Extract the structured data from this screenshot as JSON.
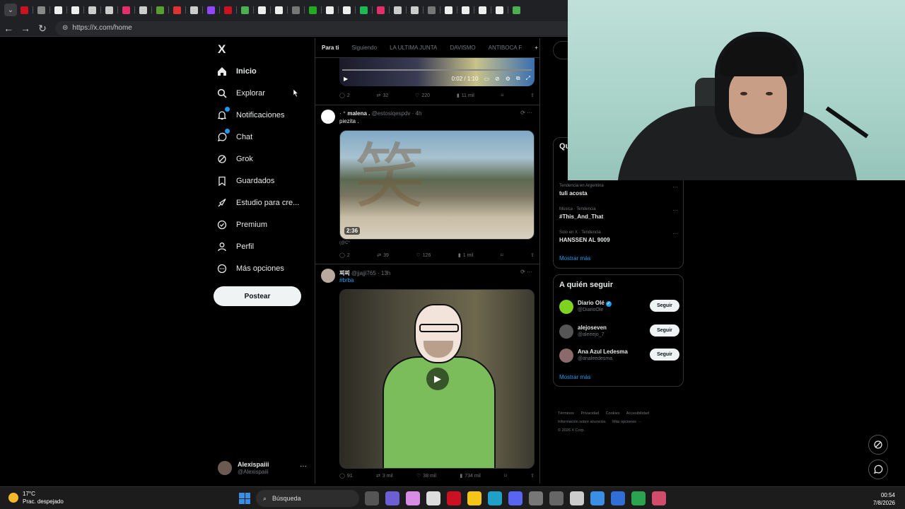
{
  "browser": {
    "url": "https://x.com/home"
  },
  "nav": {
    "logo": "X",
    "items": [
      {
        "label": "Inicio",
        "icon": "home-icon"
      },
      {
        "label": "Explorar",
        "icon": "search-icon"
      },
      {
        "label": "Notificaciones",
        "icon": "bell-icon"
      },
      {
        "label": "Chat",
        "icon": "chat-icon"
      },
      {
        "label": "Grok",
        "icon": "grok-icon"
      },
      {
        "label": "Guardados",
        "icon": "bookmark-icon"
      },
      {
        "label": "Estudio para cre...",
        "icon": "rocket-icon"
      },
      {
        "label": "Premium",
        "icon": "premium-icon"
      },
      {
        "label": "Perfil",
        "icon": "person-icon"
      },
      {
        "label": "Más opciones",
        "icon": "more-icon"
      }
    ],
    "post_label": "Postear",
    "account": {
      "name": "Alexispaiii",
      "handle": "@Alexispaiii",
      "more": "···"
    }
  },
  "feed": {
    "tabs": [
      "Para ti",
      "Siguiendo",
      "LA ULTIMA JUNTA",
      "DAVISMO",
      "ANTIBOCA F"
    ],
    "tab_plus": "+",
    "video1": {
      "time": "0:02 / 1:10"
    },
    "tweet0_actions": {
      "replies": "2",
      "retweets": "32",
      "likes": "220",
      "views": "11 mil"
    },
    "tweet1": {
      "name": "malena .",
      "handle": "@estosiqespdv · 4h",
      "text": "piezita .",
      "duration": "2:36",
      "source": "(@C*",
      "replies": "2",
      "retweets": "39",
      "likes": "126",
      "views": "1 mil"
    },
    "tweet2": {
      "name": "찌찌",
      "handle": "@jjajji765 · 13h",
      "text": "#brba",
      "replies": "91",
      "retweets": "3 mil",
      "likes": "38 mil",
      "views": "734 mil"
    }
  },
  "right": {
    "trends_title": "Qu",
    "trends": [
      {
        "cat": "Tendencia en Argentina",
        "name": "tuli acosta"
      },
      {
        "cat": "Música · Tendencia",
        "name": "#This_And_That"
      },
      {
        "cat": "Solo en X · Tendencia",
        "name": "HANSSEN AL 9009"
      }
    ],
    "show_more": "Mostrar más",
    "follow_title": "A quién seguir",
    "follow": [
      {
        "name": "Diario Olé",
        "handle": "@DiarioOle",
        "btn": "Seguir",
        "color": "#7ed321"
      },
      {
        "name": "alejoseven",
        "handle": "@aleeejo_7",
        "btn": "Seguir",
        "color": "#555"
      },
      {
        "name": "Ana Azul Ledesma",
        "handle": "@analeedesma",
        "btn": "Seguir",
        "color": "#8a6a6a"
      }
    ],
    "footer": [
      "Términos",
      "Privacidad",
      "Cookies",
      "Accesibilidad",
      "Información sobre anuncios",
      "Más opciones ···",
      "© 2026 X Corp."
    ]
  },
  "taskbar": {
    "temp": "17°C",
    "weather": "Prac. despejado",
    "search": "Búsqueda",
    "time": "00:54",
    "date": "7/8/2026"
  }
}
